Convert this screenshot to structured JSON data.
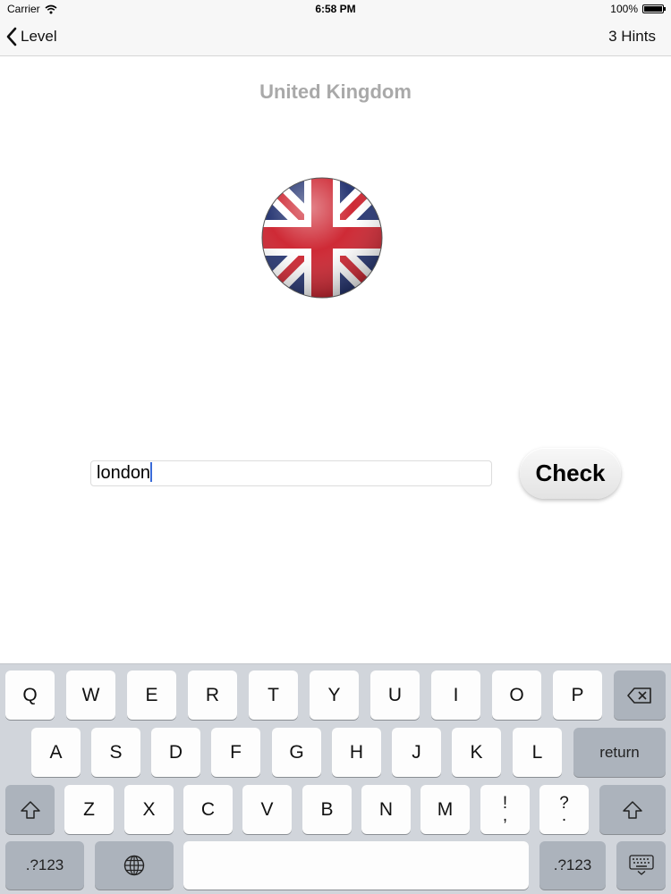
{
  "status_bar": {
    "carrier": "Carrier",
    "time": "6:58 PM",
    "battery": "100%",
    "battery_level": 1.0
  },
  "nav": {
    "back_label": "Level",
    "hints_label": "3 Hints"
  },
  "quiz": {
    "country": "United Kingdom",
    "flag_icon": "uk-flag-icon",
    "answer_value": "london",
    "check_label": "Check"
  },
  "keyboard": {
    "row1": [
      "Q",
      "W",
      "E",
      "R",
      "T",
      "Y",
      "U",
      "I",
      "O",
      "P"
    ],
    "row2": [
      "A",
      "S",
      "D",
      "F",
      "G",
      "H",
      "J",
      "K",
      "L"
    ],
    "row3": [
      "Z",
      "X",
      "C",
      "V",
      "B",
      "N",
      "M"
    ],
    "punct1": {
      "top": "!",
      "bottom": ","
    },
    "punct2": {
      "top": "?",
      "bottom": "."
    },
    "return_label": "return",
    "numbers_label": ".?123",
    "icons": [
      "backspace-icon",
      "shift-icon",
      "globe-icon",
      "keyboard-dismiss-icon"
    ]
  }
}
